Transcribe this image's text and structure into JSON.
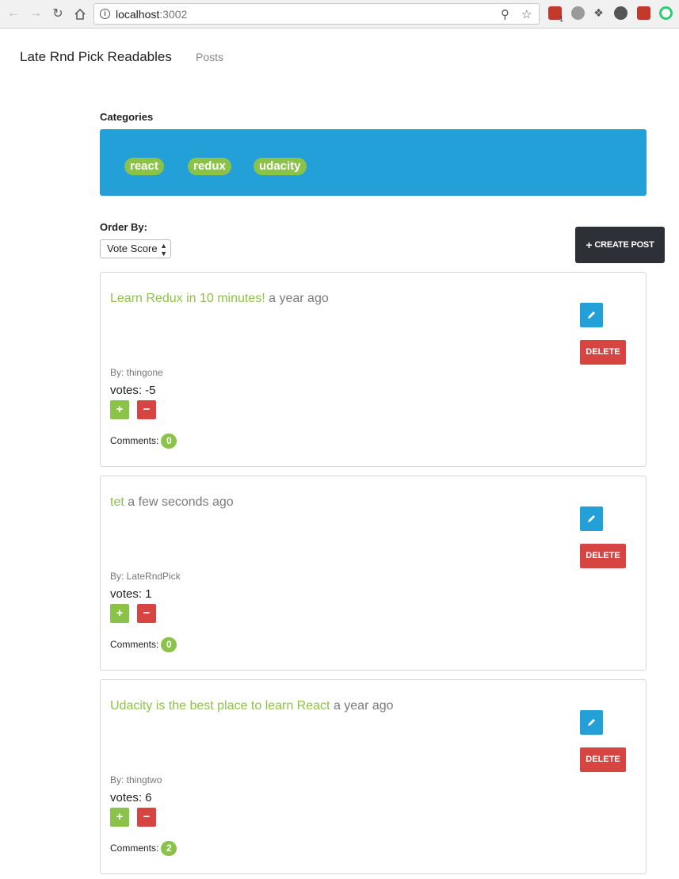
{
  "browser": {
    "url_host": "localhost",
    "url_port": ":3002",
    "back_icon": "arrow-left-icon",
    "forward_icon": "arrow-right-icon",
    "reload_icon": "reload-icon",
    "home_icon": "home-icon",
    "extension_badge": "1"
  },
  "header": {
    "brand": "Late Rnd Pick Readables",
    "nav_posts": "Posts"
  },
  "categories": {
    "label": "Categories",
    "items": [
      "react",
      "redux",
      "udacity"
    ]
  },
  "order": {
    "label": "Order By:",
    "selected": "Vote Score"
  },
  "create_button": {
    "icon": "+",
    "label": "CREATE POST"
  },
  "posts": [
    {
      "title": "Learn Redux in 10 minutes!",
      "time": "a year ago",
      "author": "By: thingone",
      "votes": "votes: -5",
      "comments_label": "Comments:",
      "comments_count": "0"
    },
    {
      "title": "tet",
      "time": "a few seconds ago",
      "author": "By: LateRndPick",
      "votes": "votes: 1",
      "comments_label": "Comments:",
      "comments_count": "0"
    },
    {
      "title": "Udacity is the best place to learn React",
      "time": "a year ago",
      "author": "By: thingtwo",
      "votes": "votes: 6",
      "comments_label": "Comments:",
      "comments_count": "2"
    }
  ],
  "actions": {
    "delete_label": "DELETE",
    "vote_up": "+",
    "vote_down": "−"
  },
  "colors": {
    "accent_green": "#8bc34a",
    "accent_blue": "#24a0d8",
    "danger_red": "#d64541",
    "dark_button": "#2d3137"
  }
}
